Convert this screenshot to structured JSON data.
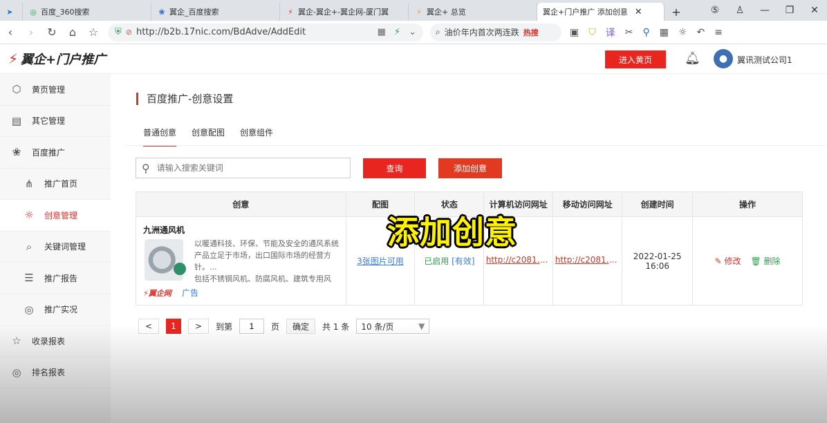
{
  "browser": {
    "tabs": [
      {
        "label": "百度_360搜索",
        "active": false
      },
      {
        "label": "翼企_百度搜索",
        "active": false
      },
      {
        "label": "翼企-翼企+-翼企网-厦门翼",
        "active": false
      },
      {
        "label": "翼企+ 总览",
        "active": false
      },
      {
        "label": "翼企+门户推广 添加创意",
        "active": true
      }
    ],
    "new_tab": "+",
    "url": "http://b2b.17nic.com/BdAdve/AddEdit",
    "search_text": "油价年内首次两连跌",
    "search_hot": "热搜"
  },
  "app": {
    "logo": "翼企+门户推广",
    "header_button": "进入黄页",
    "company": "翼讯测试公司1"
  },
  "sidebar": {
    "items": [
      {
        "label": "黄页管理",
        "icon": "cube-icon",
        "glyph": "⬡"
      },
      {
        "label": "其它管理",
        "icon": "document-icon",
        "glyph": "▤"
      },
      {
        "label": "百度推广",
        "icon": "paw-icon",
        "glyph": "❀"
      },
      {
        "label": "推广首页",
        "icon": "share-icon",
        "glyph": "⋔"
      },
      {
        "label": "创意管理",
        "icon": "bulb-icon",
        "glyph": "☼"
      },
      {
        "label": "关键词管理",
        "icon": "search-icon",
        "glyph": "⌕"
      },
      {
        "label": "推广报告",
        "icon": "report-icon",
        "glyph": "☰"
      },
      {
        "label": "推广实况",
        "icon": "target-icon",
        "glyph": "◎"
      },
      {
        "label": "收录报表",
        "icon": "star-icon",
        "glyph": "☆"
      },
      {
        "label": "排名报表",
        "icon": "target-icon",
        "glyph": "◎"
      }
    ]
  },
  "main": {
    "title": "百度推广-创意设置",
    "tabs": [
      "普通创意",
      "创意配图",
      "创意组件"
    ],
    "search_placeholder": "请输入搜索关键词",
    "query_button": "查询",
    "add_button": "添加创意",
    "table": {
      "headers": [
        "创意",
        "配图",
        "状态",
        "计算机访问网址",
        "移动访问网址",
        "创建时间",
        "操作"
      ],
      "rows": [
        {
          "title": "九洲通风机",
          "desc": "以暖通科技、环保、节能及安全的通风系统产品立足于市场，出口国际市场的经营方针。...",
          "desc2": "包括不锈钢风机、防腐风机、建筑专用风",
          "brand": "翼企网",
          "ad": "广告",
          "images": "3张图片可用",
          "status": "已启用",
          "status_valid": "[有效]",
          "pc_url": "http://c2081.35...",
          "mobile_url": "http://c2081.35...",
          "created": "2022-01-25 16:06",
          "edit": "修改",
          "delete": "删除"
        }
      ]
    },
    "pager": {
      "prev": "<",
      "current": "1",
      "next": ">",
      "goto_label": "到第",
      "goto_value": "1",
      "page_unit": "页",
      "confirm": "确定",
      "total": "共 1 条",
      "page_size": "10 条/页"
    }
  },
  "caption": "添加创意"
}
